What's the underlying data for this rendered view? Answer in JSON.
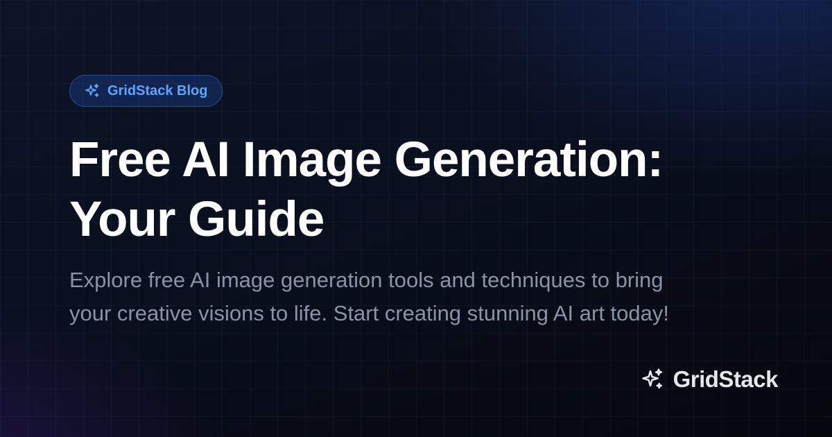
{
  "badge": {
    "icon": "sparkles-icon",
    "label": "GridStack Blog",
    "color": "#60a5fa"
  },
  "headline": "Free AI Image Generation: Your Guide",
  "description": "Explore free AI image generation tools and techniques to bring your creative visions to life. Start creating stunning AI art today!",
  "brand": {
    "icon": "sparkles-icon",
    "name": "GridStack"
  },
  "colors": {
    "background": "#0b1020",
    "headline": "#ffffff",
    "description": "#8b93a7",
    "accent": "#60a5fa"
  }
}
